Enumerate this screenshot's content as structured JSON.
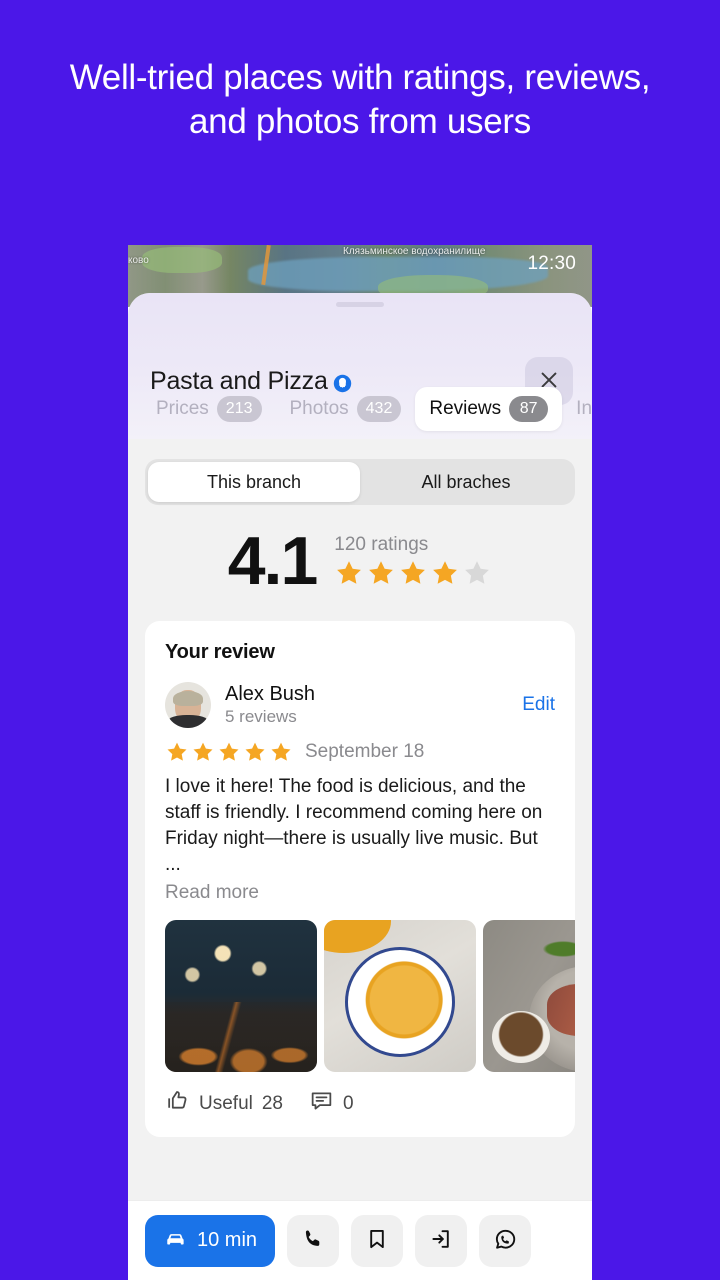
{
  "promo": {
    "headline": "Well-tried places with ratings, reviews, and photos from users"
  },
  "colors": {
    "background": "#4B17E8",
    "accent_blue": "#1A73E8",
    "star_gold": "#F5A623",
    "star_empty": "#D8D8D8"
  },
  "status_bar": {
    "time": "12:30"
  },
  "map": {
    "label_lake": "Клязьминское водохранилище",
    "label_town": "ково"
  },
  "sheet": {
    "title": "Pasta and Pizza",
    "verified_icon": "verified-badge-icon",
    "close_icon": "close-icon",
    "tabs": [
      {
        "label": "Prices",
        "badge": "213",
        "active": false
      },
      {
        "label": "Photos",
        "badge": "432",
        "active": false
      },
      {
        "label": "Reviews",
        "badge": "87",
        "active": true
      },
      {
        "label": "Info",
        "badge": "",
        "active": false
      }
    ]
  },
  "segmented": {
    "options": [
      {
        "label": "This branch",
        "active": true
      },
      {
        "label": "All braches",
        "active": false
      }
    ]
  },
  "rating": {
    "score": "4.1",
    "count_label": "120 ratings",
    "stars_filled": 4,
    "stars_total": 5
  },
  "review": {
    "card_title": "Your review",
    "author": "Alex Bush",
    "author_reviews": "5 reviews",
    "edit_label": "Edit",
    "stars": 5,
    "date": "September 18",
    "text": "I love it here! The food is delicious, and the staff is friendly. I recommend coming here on Friday night—there is usually live music. But ...",
    "read_more_label": "Read more",
    "useful_label": "Useful",
    "useful_count": "28",
    "comments_count": "0",
    "photos": [
      {
        "alt": "restaurant-interior"
      },
      {
        "alt": "pumpkin-soup"
      },
      {
        "alt": "meat-dish"
      }
    ]
  },
  "bottom_bar": {
    "route_label": "10 min",
    "route_icon": "car-icon",
    "actions": [
      {
        "icon": "phone-icon"
      },
      {
        "icon": "bookmark-icon"
      },
      {
        "icon": "share-exit-icon"
      },
      {
        "icon": "whatsapp-icon"
      }
    ]
  }
}
